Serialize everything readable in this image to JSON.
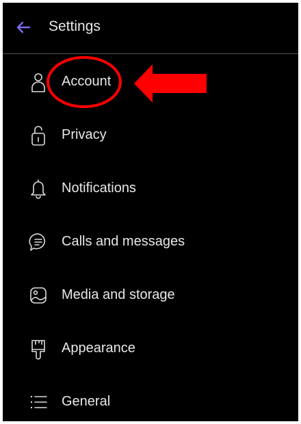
{
  "header": {
    "title": "Settings",
    "back_icon": "arrow-left-icon",
    "accent_color": "#7b6cf5"
  },
  "settings": {
    "items": [
      {
        "label": "Account",
        "icon": "person-icon"
      },
      {
        "label": "Privacy",
        "icon": "lock-icon"
      },
      {
        "label": "Notifications",
        "icon": "bell-icon"
      },
      {
        "label": "Calls and messages",
        "icon": "chat-bubble-icon"
      },
      {
        "label": "Media and storage",
        "icon": "image-icon"
      },
      {
        "label": "Appearance",
        "icon": "paint-brush-icon"
      },
      {
        "label": "General",
        "icon": "list-icon"
      }
    ]
  },
  "annotation": {
    "highlight_color": "#ff0000",
    "highlight_target": "Account"
  }
}
